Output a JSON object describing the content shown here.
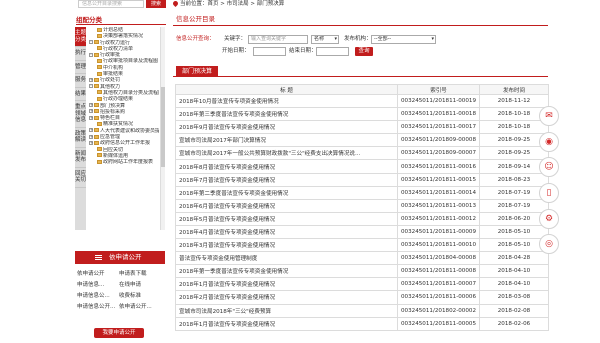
{
  "colors": {
    "accent": "#c11d1d",
    "icon": "#d42a2a"
  },
  "search": {
    "placeholder": "信息公开目录搜索",
    "button": "搜索"
  },
  "category": {
    "title": "组配分类",
    "tabs": [
      "主题分类",
      "执行",
      "管理",
      "服务",
      "结果",
      "重点领域信息",
      "政策解读",
      "新闻发布",
      "回应关切"
    ],
    "tree": [
      {
        "label": "计划总结",
        "icon": "folder"
      },
      {
        "label": "决策部署落实情况",
        "icon": "folder"
      },
      {
        "label": "行政权力运行",
        "icon": "folder",
        "toggle": "-"
      },
      {
        "label": "行政权力清单",
        "icon": "folder"
      },
      {
        "label": "行政审批",
        "icon": "folder",
        "toggle": "-"
      },
      {
        "label": "行政审批项目录及流程图",
        "icon": "folder"
      },
      {
        "label": "中介机构",
        "icon": "folder"
      },
      {
        "label": "审批结果",
        "icon": "folder"
      },
      {
        "label": "行政处罚",
        "icon": "folder",
        "toggle": "+"
      },
      {
        "label": "其他权力",
        "icon": "folder",
        "toggle": "-"
      },
      {
        "label": "其他权力目录分类及流程图",
        "icon": "folder"
      },
      {
        "label": "行政办理结果",
        "icon": "folder"
      },
      {
        "label": "部门预决算",
        "icon": "folder",
        "toggle": "+"
      },
      {
        "label": "招投标采购",
        "icon": "folder",
        "toggle": "+"
      },
      {
        "label": "特色栏目",
        "icon": "folder",
        "toggle": "+"
      },
      {
        "label": "精准扶贫情况",
        "icon": "folder"
      },
      {
        "label": "人大代表建议和政协委员提案办理",
        "icon": "folder",
        "toggle": "+"
      },
      {
        "label": "应急管理",
        "icon": "folder",
        "toggle": "+"
      },
      {
        "label": "政府信息公开工作年报",
        "icon": "folder",
        "toggle": "+"
      },
      {
        "label": "回应关切",
        "icon": "folder"
      },
      {
        "label": "新媒体运用",
        "icon": "folder"
      },
      {
        "label": "政府网站工作年度报表",
        "icon": "folder"
      }
    ]
  },
  "apply": {
    "title": "依申请公开",
    "links": [
      [
        "依申请公开",
        "申请表下载"
      ],
      [
        "申请信息...",
        "在线申请"
      ],
      [
        "申请信息公...",
        "收费标准"
      ],
      [
        "申请信息公开...",
        "依申请公开..."
      ]
    ],
    "button": "我要申请公开"
  },
  "breadcrumb": "当前位置：首页 > 市司法局 > 部门预决算",
  "section_title": "信息公开目录",
  "query": {
    "label": "信息公开查询：",
    "keyword_label": "关键字：",
    "keyword_placeholder": "输入查询关键字",
    "field_value": "名称",
    "org_label": "发布机构：",
    "org_value": "--全部--",
    "start_label": "开始日期：",
    "end_label": "结束日期：",
    "button": "查询"
  },
  "tab": "部门预决算",
  "table": {
    "headers": [
      "标 题",
      "索引号",
      "发布时间"
    ],
    "rows": [
      [
        "2018年10月普法宣传专项资金使用情况",
        "003245011/201811-00019",
        "2018-11-12"
      ],
      [
        "2018年第三季度普法宣传专项资金使用情况",
        "003245011/201811-00018",
        "2018-10-18"
      ],
      [
        "2018年9月普法宣传专项资金使用情况",
        "003245011/201811-00017",
        "2018-10-18"
      ],
      [
        "宣城市司法局2017年部门决算情况",
        "003245011/201809-00008",
        "2018-09-25"
      ],
      [
        "宣城市司法局2017年一般公共预算财政拨款\"三公\"经费支出决算情况说...",
        "003245011/201809-00007",
        "2018-09-25"
      ],
      [
        "2018年8月普法宣传专项资金使用情况",
        "003245011/201811-00016",
        "2018-09-14"
      ],
      [
        "2018年7月普法宣传专项资金使用情况",
        "003245011/201811-00015",
        "2018-08-23"
      ],
      [
        "2018年第二季度普法宣传专项资金使用情况",
        "003245011/201811-00014",
        "2018-07-19"
      ],
      [
        "2018年6月普法宣传专项资金使用情况",
        "003245011/201811-00013",
        "2018-07-19"
      ],
      [
        "2018年5月普法宣传专项资金使用情况",
        "003245011/201811-00012",
        "2018-06-20"
      ],
      [
        "2018年4月普法宣传专项资金使用情况",
        "003245011/201811-00009",
        "2018-05-10"
      ],
      [
        "2018年3月普法宣传专项资金使用情况",
        "003245011/201811-00010",
        "2018-05-10"
      ],
      [
        "普法宣传专项资金使用管理制度",
        "003245011/201804-00008",
        "2018-04-28"
      ],
      [
        "2018年第一季度普法宣传专项资金使用情况",
        "003245011/201811-00008",
        "2018-04-10"
      ],
      [
        "2018年1月普法宣传专项资金使用情况",
        "003245011/201811-00007",
        "2018-04-10"
      ],
      [
        "2018年2月普法宣传专项资金使用情况",
        "003245011/201811-00006",
        "2018-03-08"
      ],
      [
        "宣城市司法局2018年\"三公\"经费预算",
        "003245011/201802-00002",
        "2018-02-08"
      ],
      [
        "2018年1月普法宣传专项资金使用情况",
        "003245011/201811-00005",
        "2018-02-06"
      ]
    ]
  },
  "floatbar": [
    {
      "icon": "mail-icon",
      "glyph": "✉"
    },
    {
      "icon": "weibo-icon",
      "glyph": "◉"
    },
    {
      "icon": "wechat-icon",
      "glyph": "☺"
    },
    {
      "icon": "mobile-icon",
      "glyph": "▯"
    },
    {
      "icon": "robot-icon",
      "glyph": "⚙"
    },
    {
      "icon": "weibo-alt-icon",
      "glyph": "◎"
    }
  ]
}
